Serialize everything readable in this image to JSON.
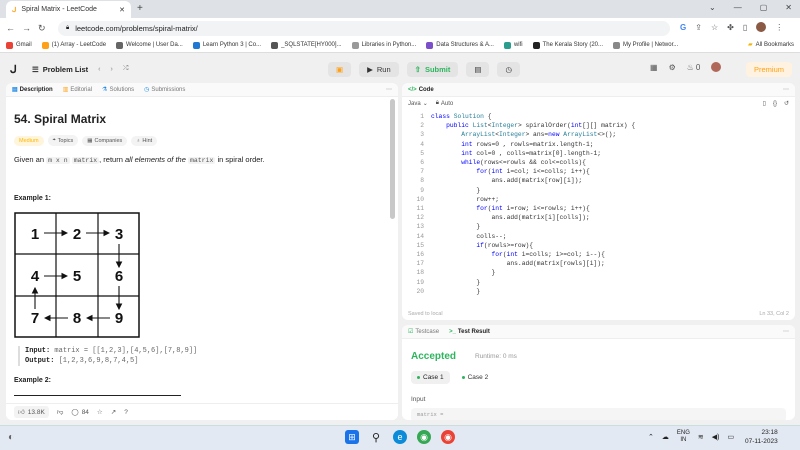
{
  "browser": {
    "tab_title": "Spiral Matrix - LeetCode",
    "url": "leetcode.com/problems/spiral-matrix/",
    "bookmarks": [
      {
        "label": "Gmail",
        "color": "#ea4335"
      },
      {
        "label": "(1) Array - LeetCode",
        "color": "#ffa116"
      },
      {
        "label": "Welcome | User Da...",
        "color": "#666666"
      },
      {
        "label": "Learn Python 3 | Co...",
        "color": "#1f78d1"
      },
      {
        "label": "_SQLSTATE[HY000]...",
        "color": "#555555"
      },
      {
        "label": "Libraries in Python...",
        "color": "#999999"
      },
      {
        "label": "Data Structures & A...",
        "color": "#7b4fc9"
      },
      {
        "label": "wifi",
        "color": "#2a9d8f"
      },
      {
        "label": "The Kerala Story (20...",
        "color": "#222222"
      },
      {
        "label": "My Profile | Networ...",
        "color": "#888888"
      }
    ],
    "all_bookmarks": "All Bookmarks"
  },
  "nav": {
    "problem_list": "Problem List",
    "run": "Run",
    "submit": "Submit",
    "streak": "0",
    "premium": "Premium"
  },
  "left": {
    "tabs": [
      "Description",
      "Editorial",
      "Solutions",
      "Submissions"
    ],
    "title": "54. Spiral Matrix",
    "badges": [
      "Medium",
      "Topics",
      "Companies",
      "Hint"
    ],
    "desc_pre": "Given an",
    "desc_code1": "m x n",
    "desc_code2": "matrix",
    "desc_mid": ", return",
    "desc_em": "all elements of the",
    "desc_code3": "matrix",
    "desc_end": "in spiral order.",
    "example1": "Example 1:",
    "matrix": [
      1,
      2,
      3,
      4,
      5,
      6,
      7,
      8,
      9
    ],
    "input_label": "Input:",
    "input_val": "matrix = [[1,2,3],[4,5,6],[7,8,9]]",
    "output_label": "Output:",
    "output_val": "[1,2,3,6,9,8,7,4,5]",
    "example2": "Example 2:",
    "likes": "13.8K",
    "comments": "84"
  },
  "code": {
    "tab": "Code",
    "lang": "Java",
    "mode": "Auto",
    "lines": [
      "class Solution {",
      "    public List<Integer> spiralOrder(int[][] matrix) {",
      "        ArrayList<Integer> ans=new ArrayList<>();",
      "        int rows=0 , rowls=matrix.length-1;",
      "        int col=0 , colls=matrix[0].length-1;",
      "        while(rows<=rowls && col<=colls){",
      "            for(int i=col; i<=colls; i++){",
      "                ans.add(matrix[row][i]);",
      "            }",
      "            row++;",
      "            for(int i=row; i<=rowls; i++){",
      "                ans.add(matrix[i][colls]);",
      "            }",
      "            colls--;",
      "            if(rowls>=row){",
      "                for(int i=colls; i>=col; i--){",
      "                    ans.add(matrix[rowls][i]);",
      "                }",
      "            }",
      "            }"
    ],
    "saved": "Saved to local",
    "cursor": "Ln 33, Col 2"
  },
  "test": {
    "tabs": [
      "Testcase",
      "Test Result"
    ],
    "status": "Accepted",
    "runtime": "Runtime: 0 ms",
    "cases": [
      "Case 1",
      "Case 2"
    ],
    "input_label": "Input",
    "input_val": "matrix ="
  },
  "taskbar": {
    "lang1": "ENG",
    "lang2": "IN",
    "time": "23:18",
    "date": "07-11-2023"
  }
}
